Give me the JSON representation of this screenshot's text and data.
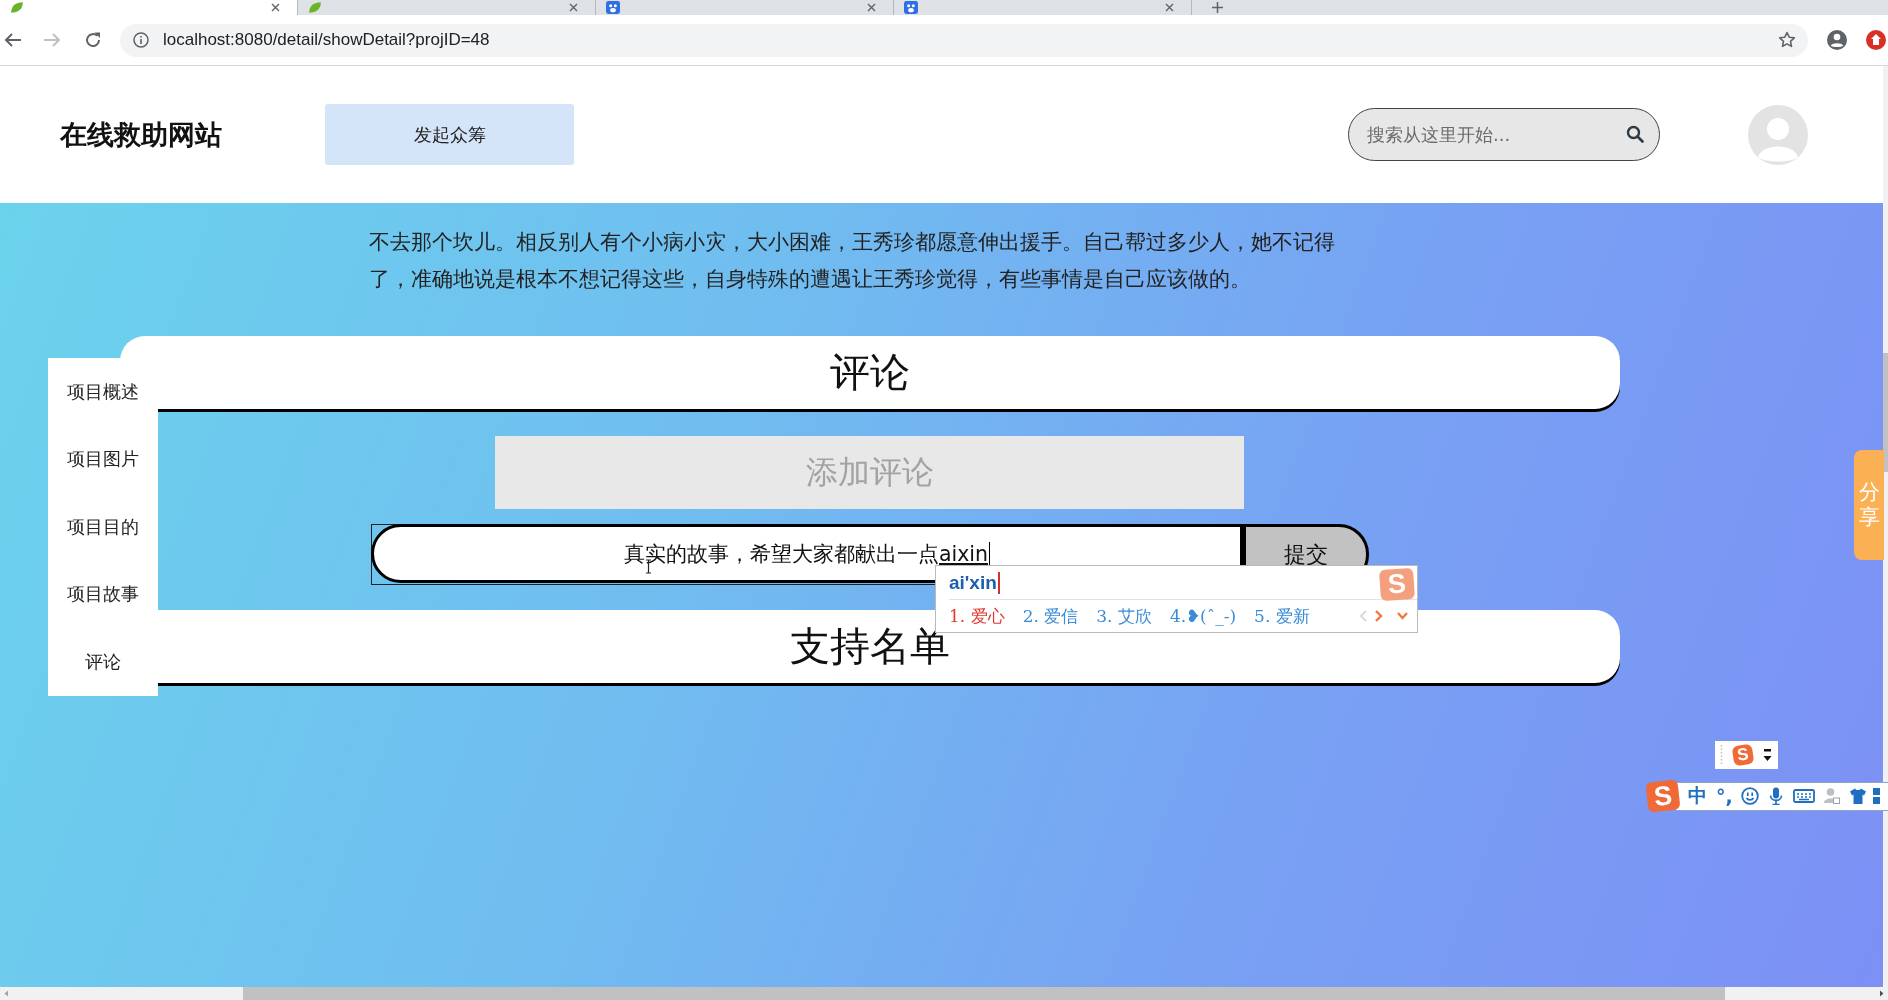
{
  "browser": {
    "tabs": [
      {
        "kind": "leaf",
        "selected": true
      },
      {
        "kind": "leaf",
        "selected": false
      },
      {
        "kind": "paw",
        "selected": false
      },
      {
        "kind": "paw",
        "selected": false
      }
    ],
    "url": "localhost:8080/detail/showDetail?projID=48"
  },
  "header": {
    "logo": "在线救助网站",
    "start_button": "发起众筹",
    "search": {
      "placeholder": "搜索从这里开始..."
    }
  },
  "story": {
    "text": "不去那个坎儿。相反别人有个小病小灾，大小困难，王秀珍都愿意伸出援手。自己帮过多少人，她不记得了，准确地说是根本不想记得这些，自身特殊的遭遇让王秀珍觉得，有些事情是自己应该做的。"
  },
  "sidebar": {
    "items": [
      {
        "label": "项目概述"
      },
      {
        "label": "项目图片"
      },
      {
        "label": "项目目的"
      },
      {
        "label": "项目故事"
      },
      {
        "label": "评论"
      }
    ]
  },
  "comments": {
    "title": "评论",
    "add_heading": "添加评论",
    "input": {
      "value": "真实的故事，希望大家都献出一点",
      "composing_text": "aixin"
    },
    "submit_button": "提交"
  },
  "supporters": {
    "title": "支持名单"
  },
  "share_tab": {
    "label": "分享"
  },
  "ime_popup": {
    "logo": "S",
    "composition": "ai'xin",
    "candidates": [
      {
        "text": "1. 爱心",
        "selected": true
      },
      {
        "text": "2. 爱信",
        "selected": false
      },
      {
        "text": "3. 艾欣",
        "selected": false
      },
      {
        "text": "4.❥(ˆ_-)",
        "selected": false
      },
      {
        "text": "5. 爱新",
        "selected": false
      }
    ]
  },
  "ime_mini_toolbar": {
    "logo": "S"
  },
  "ime_status_bar": {
    "logo": "S",
    "mode": "中",
    "punctuation": "°,"
  }
}
